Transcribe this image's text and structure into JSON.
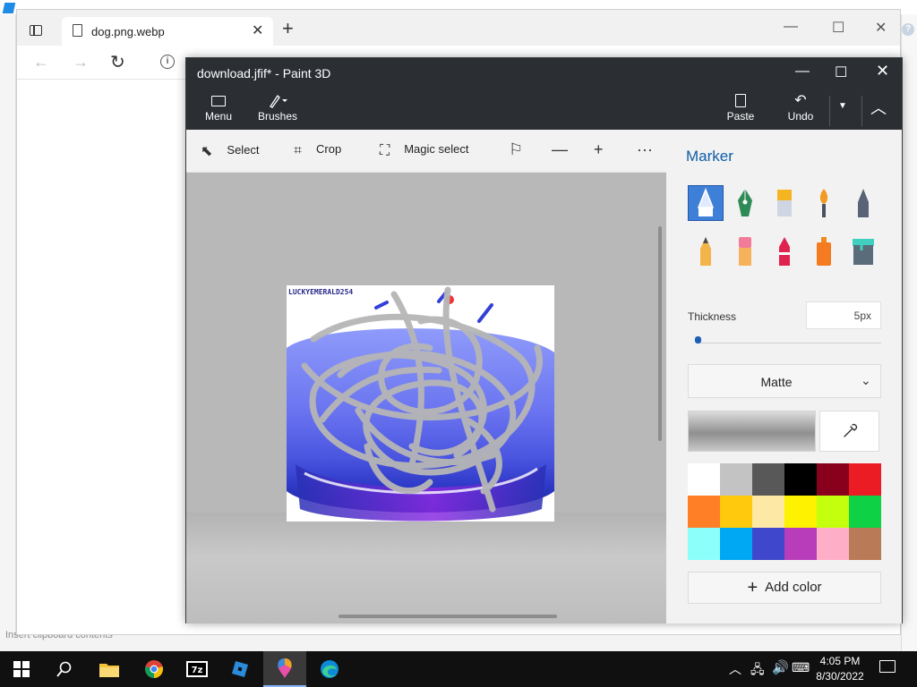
{
  "background_app": {
    "status_text": "Insert clipboard contents",
    "help_icon": "question-mark-icon"
  },
  "browser": {
    "tab_title": "dog.png.webp",
    "tab_close": "✕",
    "new_tab": "+",
    "minimize": "—",
    "maximize": "☐",
    "close": "✕",
    "nav_back": "←",
    "nav_forward": "→",
    "nav_refresh": "↻",
    "nav_info": "i"
  },
  "paint": {
    "title": "download.jfif* - Paint 3D",
    "minimize": "—",
    "maximize": "☐",
    "close": "✕",
    "ribbon": {
      "menu_label": "Menu",
      "brushes_label": "Brushes",
      "paste_label": "Paste",
      "undo_label": "Undo",
      "more": "▼",
      "collapse": "︿"
    },
    "toolbar": {
      "select_label": "Select",
      "crop_label": "Crop",
      "magic_select_label": "Magic select",
      "flag_icon": "⚐",
      "zoom_out": "—",
      "zoom_in": "+",
      "more": "···"
    },
    "canvas": {
      "watermark": "LUCKYEMERALD254"
    },
    "panel": {
      "title": "Marker",
      "brushes": [
        "marker",
        "calligraphy-pen",
        "oil-brush",
        "watercolor",
        "pixel-pen",
        "pencil",
        "eraser",
        "crayon",
        "spray-can",
        "fill"
      ],
      "selected_brush": "marker",
      "thickness_label": "Thickness",
      "thickness_value": "5px",
      "thickness_fraction": 0.03,
      "finish_value": "Matte",
      "finish_chevron": "⌄",
      "eyedropper_icon": "eyedropper-icon",
      "palette": [
        "#ffffff",
        "#c3c3c3",
        "#585858",
        "#000000",
        "#88001b",
        "#ec1c24",
        "#ff7f27",
        "#ffc90e",
        "#fde9a5",
        "#fff200",
        "#c4ff0e",
        "#0ed145",
        "#8cfffb",
        "#00a8f3",
        "#3f48cc",
        "#b83dba",
        "#ffaec8",
        "#b97a57"
      ],
      "add_color_label": "Add color"
    }
  },
  "taskbar": {
    "time": "4:05 PM",
    "date": "8/30/2022",
    "chevron": "︿",
    "lang_icon": "⌨",
    "volume_icon": "🔊",
    "network_icon": "🖧"
  },
  "colors": {
    "paint_titlebar": "#2b2e33",
    "accent": "#0f5ea8",
    "taskbar": "#101010"
  }
}
